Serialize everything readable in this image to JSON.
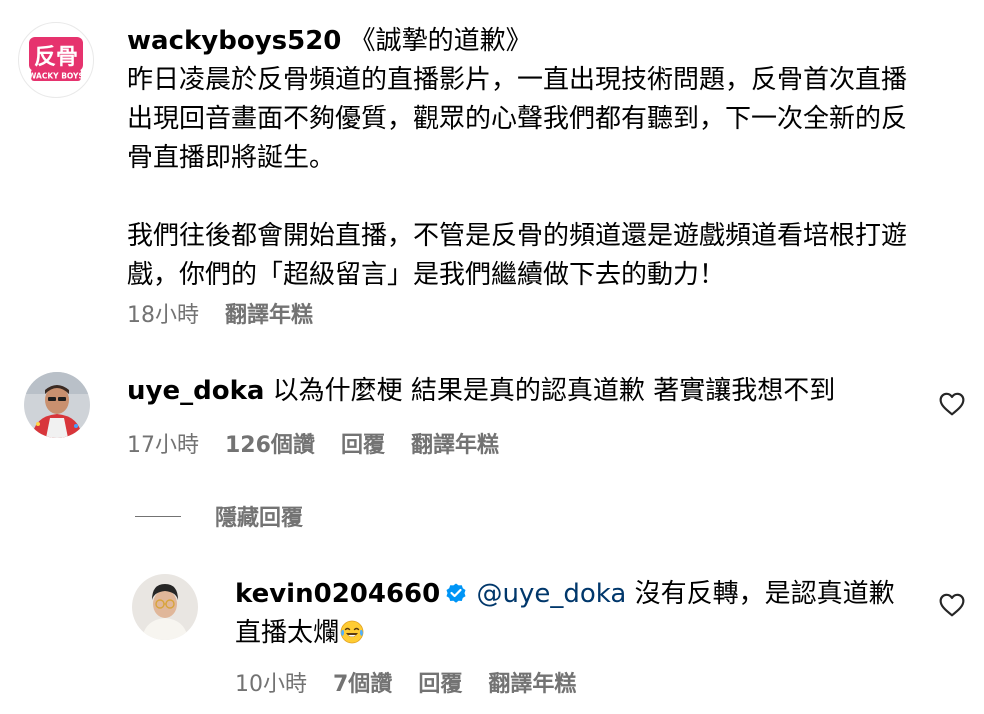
{
  "post": {
    "username": "wackyboys520",
    "avatar_text": "反骨",
    "avatar_subtext": "WACKY BOYS",
    "title": "《誠摯的道歉》",
    "paragraph1": "昨日凌晨於反骨頻道的直播影片，一直出現技術問題，反骨首次直播出現回音畫面不夠優質，觀眾的心聲我們都有聽到，下一次全新的反骨直播即將誕生。",
    "paragraph2": "我們往後都會開始直播，不管是反骨的頻道還是遊戲頻道看培根打遊戲，你們的「超級留言」是我們繼續做下去的動力！",
    "time": "18小時",
    "translate": "翻譯年糕"
  },
  "comment1": {
    "username": "uye_doka",
    "text": "以為什麼梗 結果是真的認真道歉 著實讓我想不到",
    "time": "17小時",
    "likes": "126個讚",
    "reply": "回覆",
    "translate": "翻譯年糕",
    "heart_icon": "heart-outline-icon"
  },
  "replies_toggle": {
    "label": "隱藏回覆"
  },
  "reply1": {
    "username": "kevin0204660",
    "verified_icon": "verified-badge-icon",
    "mention": "@uye_doka",
    "text": "沒有反轉，是認真道歉直播太爛",
    "emoji": "face-with-tears-of-joy",
    "time": "10小時",
    "likes": "7個讚",
    "reply": "回覆",
    "translate": "翻譯年糕",
    "heart_icon": "heart-outline-icon"
  },
  "colors": {
    "text": "#000000",
    "secondary": "#737373",
    "mention": "#00376b",
    "verified": "#0095f6",
    "brand_pink": "#e6336e"
  }
}
